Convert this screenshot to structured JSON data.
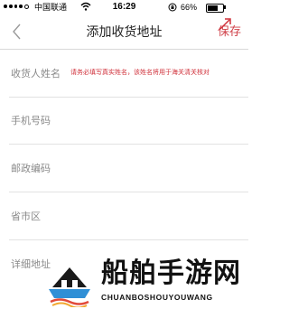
{
  "status_bar": {
    "carrier": "中国联通",
    "time": "16:29",
    "battery_percent": "66%",
    "battery_level": 0.66,
    "signal_bars_filled": 4,
    "signal_bars_total": 5
  },
  "nav": {
    "title": "添加收货地址",
    "save_label": "保存",
    "back_icon": "chevron-left-icon"
  },
  "form": {
    "fields": [
      {
        "label": "收货人姓名",
        "hint": "请务必填写真实姓名，该姓名将用于海关清关核对"
      },
      {
        "label": "手机号码",
        "hint": ""
      },
      {
        "label": "邮政编码",
        "hint": ""
      },
      {
        "label": "省市区",
        "hint": ""
      },
      {
        "label": "详细地址",
        "hint": ""
      }
    ]
  },
  "watermark": {
    "title": "船舶手游网",
    "subtitle": "CHUANBOSHOUYOUWANG"
  },
  "colors": {
    "accent": "#d0424a",
    "hint": "#d0303a",
    "label": "#8a8a8a",
    "divider": "#e2e2e2"
  }
}
